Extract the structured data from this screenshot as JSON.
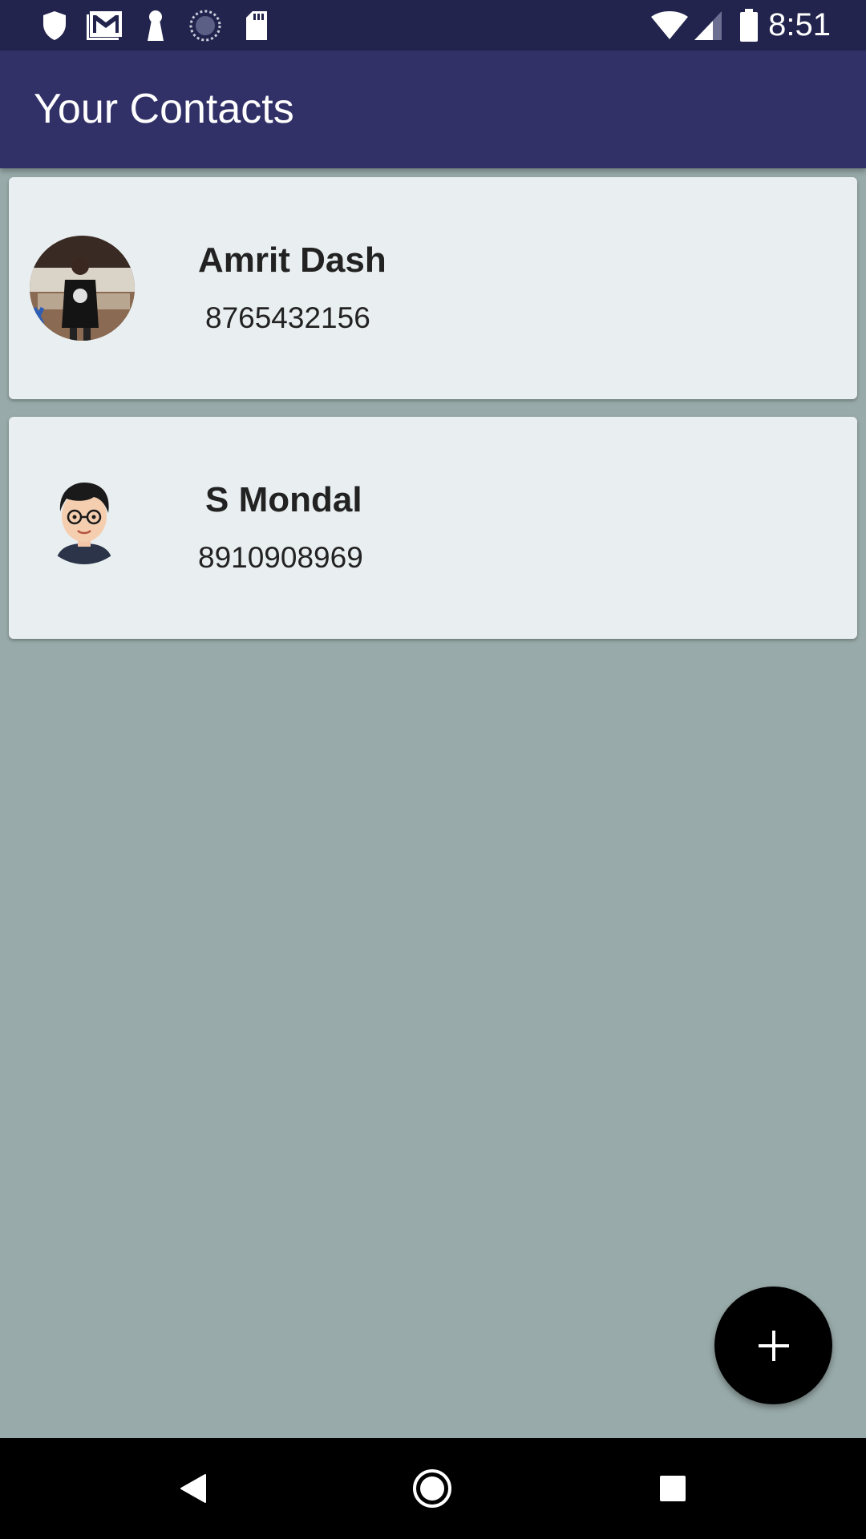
{
  "status_bar": {
    "time": "8:51",
    "left_icons": [
      "shield-icon",
      "gmail-icon",
      "keyhole-icon",
      "sync-icon",
      "sd-card-icon"
    ],
    "right_icons": [
      "wifi-icon",
      "signal-icon",
      "battery-icon"
    ]
  },
  "app_bar": {
    "title": "Your Contacts"
  },
  "contacts": [
    {
      "name": "Amrit Dash",
      "phone": "8765432156"
    },
    {
      "name": "S Mondal",
      "phone": "8910908969"
    }
  ],
  "fab": {
    "icon": "plus-icon"
  },
  "nav_bar": {
    "buttons": [
      "back-icon",
      "home-icon",
      "recents-icon"
    ]
  },
  "colors": {
    "status_bar": "#22244e",
    "app_bar": "#313168",
    "background": "#98aaa9",
    "card": "#e9eef0",
    "fab": "#000000"
  }
}
